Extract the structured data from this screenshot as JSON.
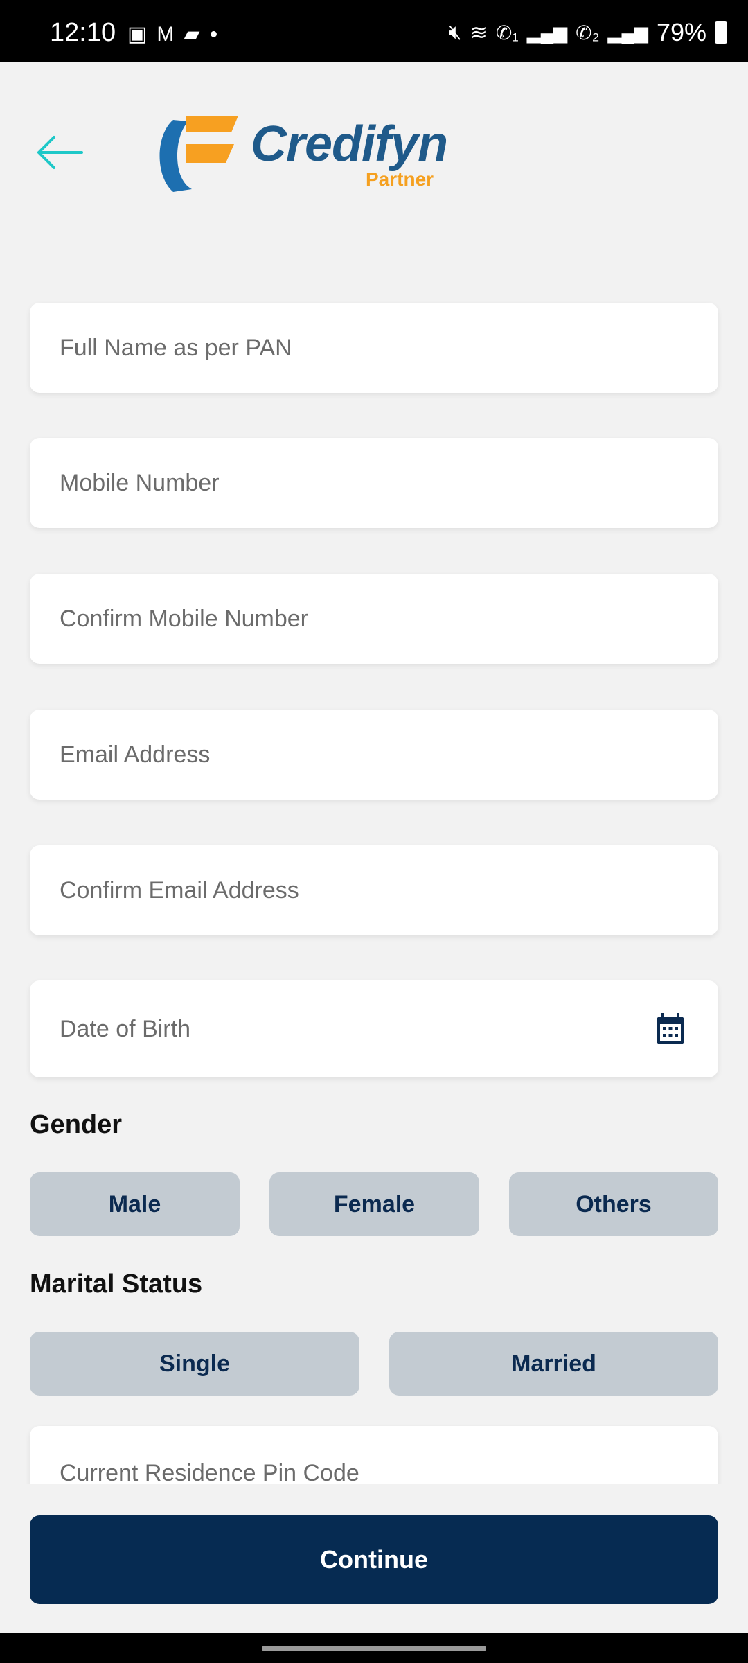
{
  "status_bar": {
    "time": "12:10",
    "battery": "79%",
    "left_icons": [
      "gallery-icon",
      "gmail-icon",
      "message-icon",
      "dot-icon"
    ],
    "right_icons": [
      "mute-icon",
      "wifi-icon",
      "wifi-call-1-icon",
      "signal-icon",
      "wifi-call-2-icon",
      "signal-icon",
      "battery-charging-icon"
    ]
  },
  "header": {
    "back_icon": "arrow-left-icon",
    "logo_text": "Credifyn",
    "logo_subtext": "Partner",
    "accent": "#1ec8c8"
  },
  "form": {
    "fields": [
      {
        "placeholder": "Full Name as per PAN",
        "value": ""
      },
      {
        "placeholder": "Mobile Number",
        "value": ""
      },
      {
        "placeholder": "Confirm Mobile Number",
        "value": ""
      },
      {
        "placeholder": "Email Address",
        "value": ""
      },
      {
        "placeholder": "Confirm Email Address",
        "value": ""
      },
      {
        "placeholder": "Date of Birth",
        "value": "",
        "icon": "calendar-icon"
      },
      {
        "placeholder": "Current Residence Pin Code",
        "value": ""
      }
    ],
    "gender": {
      "label": "Gender",
      "options": [
        "Male",
        "Female",
        "Others"
      ]
    },
    "marital": {
      "label": "Marital Status",
      "options": [
        "Single",
        "Married"
      ]
    }
  },
  "footer": {
    "continue_label": "Continue",
    "button_color": "#062b52"
  }
}
